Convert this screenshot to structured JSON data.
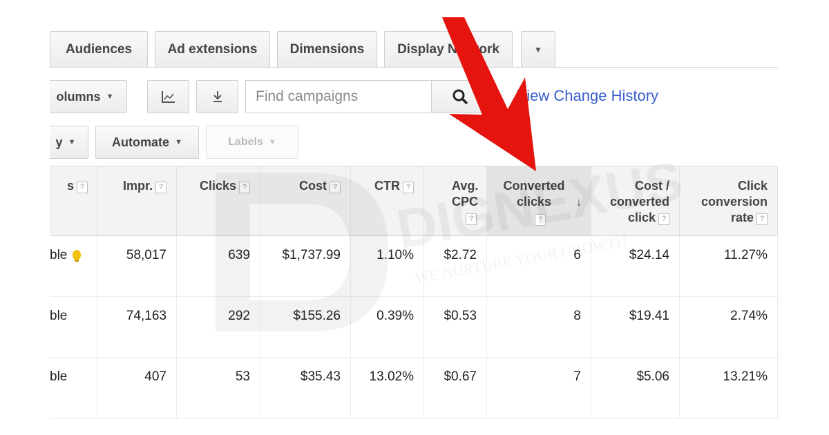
{
  "tabs": [
    {
      "label": "Audiences"
    },
    {
      "label": "Ad extensions"
    },
    {
      "label": "Dimensions"
    },
    {
      "label": "Display Network"
    }
  ],
  "toolbar": {
    "columns_label": "olumns",
    "search_placeholder": "Find campaigns",
    "history_link": "View Change History",
    "bid_strategy_label": "y",
    "automate_label": "Automate",
    "labels_label": "Labels"
  },
  "table": {
    "headers": [
      {
        "label": "s",
        "help": "?"
      },
      {
        "label": "Impr.",
        "help": "?"
      },
      {
        "label": "Clicks",
        "help": "?"
      },
      {
        "label": "Cost",
        "help": "?"
      },
      {
        "label": "CTR",
        "help": "?"
      },
      {
        "label": "Avg. CPC",
        "help": "?"
      },
      {
        "label": "Converted clicks",
        "help": "?",
        "sorted": "descending"
      },
      {
        "label": "Cost / converted click",
        "help": "?"
      },
      {
        "label": "Click conversion rate",
        "help": "?"
      }
    ],
    "rows": [
      {
        "status": "ble",
        "bulb": true,
        "impr": "58,017",
        "clicks": "639",
        "cost": "$1,737.99",
        "ctr": "1.10%",
        "cpc": "$2.72",
        "conv": "6",
        "cost_conv": "$24.14",
        "conv_rate": "11.27%"
      },
      {
        "status": "ble",
        "bulb": false,
        "impr": "74,163",
        "clicks": "292",
        "cost": "$155.26",
        "ctr": "0.39%",
        "cpc": "$0.53",
        "conv": "8",
        "cost_conv": "$19.41",
        "conv_rate": "2.74%"
      },
      {
        "status": "ble",
        "bulb": false,
        "impr": "407",
        "clicks": "53",
        "cost": "$35.43",
        "ctr": "13.02%",
        "cpc": "$0.67",
        "conv": "7",
        "cost_conv": "$5.06",
        "conv_rate": "13.21%"
      }
    ]
  },
  "watermark": {
    "name": "DIGNEXUS",
    "tagline": "WE NURTURE YOUR GROWTH"
  },
  "colors": {
    "annotation_arrow": "#e5140f",
    "link": "#3a5fcd",
    "bulb": "#f4c20d"
  }
}
